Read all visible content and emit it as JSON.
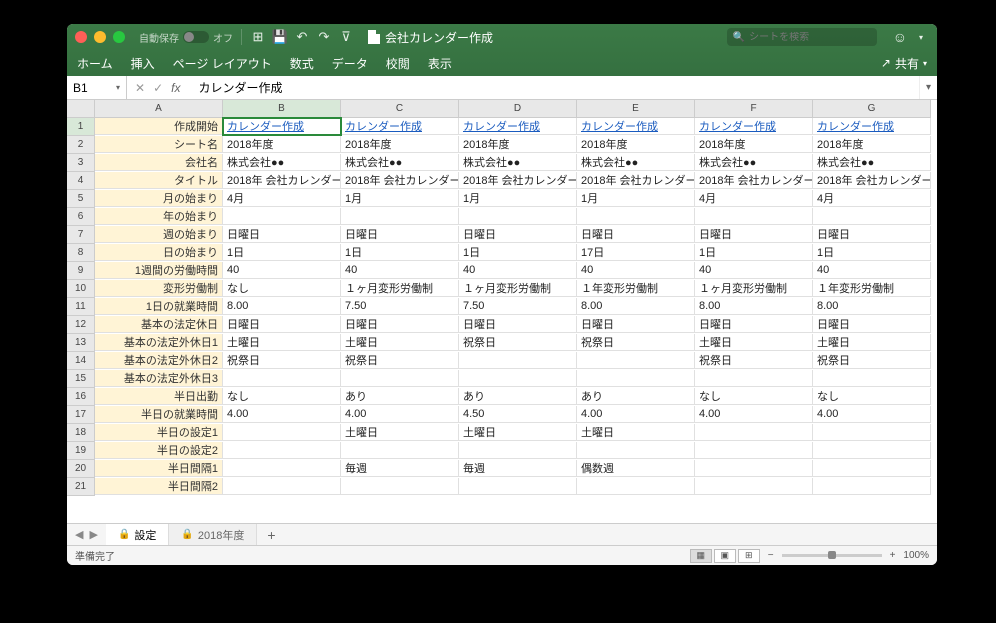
{
  "titlebar": {
    "autosave_label": "自動保存",
    "autosave_state": "オフ",
    "doc_title": "会社カレンダー作成",
    "search_placeholder": "シートを検索"
  },
  "ribbon": {
    "tabs": [
      "ホーム",
      "挿入",
      "ページ レイアウト",
      "数式",
      "データ",
      "校閲",
      "表示"
    ],
    "share_label": "共有"
  },
  "formula_bar": {
    "name_box": "B1",
    "fx_label": "fx",
    "formula": "カレンダー作成"
  },
  "columns": [
    "A",
    "B",
    "C",
    "D",
    "E",
    "F",
    "G"
  ],
  "rows": [
    {
      "n": 1,
      "label": "作成開始",
      "cells": [
        "カレンダー作成",
        "カレンダー作成",
        "カレンダー作成",
        "カレンダー作成",
        "カレンダー作成",
        "カレンダー作成"
      ],
      "link": true
    },
    {
      "n": 2,
      "label": "シート名",
      "cells": [
        "2018年度",
        "2018年度",
        "2018年度",
        "2018年度",
        "2018年度",
        "2018年度"
      ]
    },
    {
      "n": 3,
      "label": "会社名",
      "cells": [
        "株式会社●●",
        "株式会社●●",
        "株式会社●●",
        "株式会社●●",
        "株式会社●●",
        "株式会社●●"
      ]
    },
    {
      "n": 4,
      "label": "タイトル",
      "cells": [
        "2018年 会社カレンダー",
        "2018年 会社カレンダー",
        "2018年 会社カレンダー",
        "2018年 会社カレンダー",
        "2018年 会社カレンダー",
        "2018年 会社カレンダー"
      ]
    },
    {
      "n": 5,
      "label": "月の始まり",
      "cells": [
        "4月",
        "1月",
        "1月",
        "1月",
        "4月",
        "4月"
      ]
    },
    {
      "n": 6,
      "label": "年の始まり",
      "cells": [
        " ",
        " ",
        " ",
        " ",
        " ",
        " "
      ]
    },
    {
      "n": 7,
      "label": "週の始まり",
      "cells": [
        "日曜日",
        "日曜日",
        "日曜日",
        "日曜日",
        "日曜日",
        "日曜日"
      ]
    },
    {
      "n": 8,
      "label": "日の始まり",
      "cells": [
        "1日",
        "1日",
        "1日",
        "17日",
        "1日",
        "1日"
      ]
    },
    {
      "n": 9,
      "label": "1週間の労働時間",
      "cells": [
        "40",
        "40",
        "40",
        "40",
        "40",
        "40"
      ]
    },
    {
      "n": 10,
      "label": "変形労働制",
      "cells": [
        "なし",
        "１ヶ月変形労働制",
        "１ヶ月変形労働制",
        "１年変形労働制",
        "１ヶ月変形労働制",
        "１年変形労働制"
      ]
    },
    {
      "n": 11,
      "label": "1日の就業時間",
      "cells": [
        "8.00",
        "7.50",
        "7.50",
        "8.00",
        "8.00",
        "8.00"
      ]
    },
    {
      "n": 12,
      "label": "基本の法定休日",
      "cells": [
        "日曜日",
        "日曜日",
        "日曜日",
        "日曜日",
        "日曜日",
        "日曜日"
      ]
    },
    {
      "n": 13,
      "label": "基本の法定外休日1",
      "cells": [
        "土曜日",
        "土曜日",
        "祝祭日",
        "祝祭日",
        "土曜日",
        "土曜日"
      ]
    },
    {
      "n": 14,
      "label": "基本の法定外休日2",
      "cells": [
        "祝祭日",
        "祝祭日",
        "",
        "",
        "祝祭日",
        "祝祭日"
      ]
    },
    {
      "n": 15,
      "label": "基本の法定外休日3",
      "cells": [
        "",
        "",
        "",
        "",
        "",
        ""
      ]
    },
    {
      "n": 16,
      "label": "半日出勤",
      "cells": [
        "なし",
        "あり",
        "あり",
        "あり",
        "なし",
        "なし"
      ]
    },
    {
      "n": 17,
      "label": "半日の就業時間",
      "cells": [
        "4.00",
        "4.00",
        "4.50",
        "4.00",
        "4.00",
        "4.00"
      ]
    },
    {
      "n": 18,
      "label": "半日の設定1",
      "cells": [
        "",
        "土曜日",
        "土曜日",
        "土曜日",
        "",
        ""
      ]
    },
    {
      "n": 19,
      "label": "半日の設定2",
      "cells": [
        "",
        "",
        "",
        "",
        "",
        ""
      ]
    },
    {
      "n": 20,
      "label": "半日間隔1",
      "cells": [
        "",
        "毎週",
        "毎週",
        "偶数週",
        "",
        ""
      ]
    },
    {
      "n": 21,
      "label": "半日間隔2",
      "cells": [
        "",
        "",
        "",
        "",
        "",
        ""
      ]
    }
  ],
  "sheet_tabs": {
    "tab1": "設定",
    "tab2": "2018年度"
  },
  "statusbar": {
    "ready": "準備完了",
    "zoom": "100%"
  }
}
